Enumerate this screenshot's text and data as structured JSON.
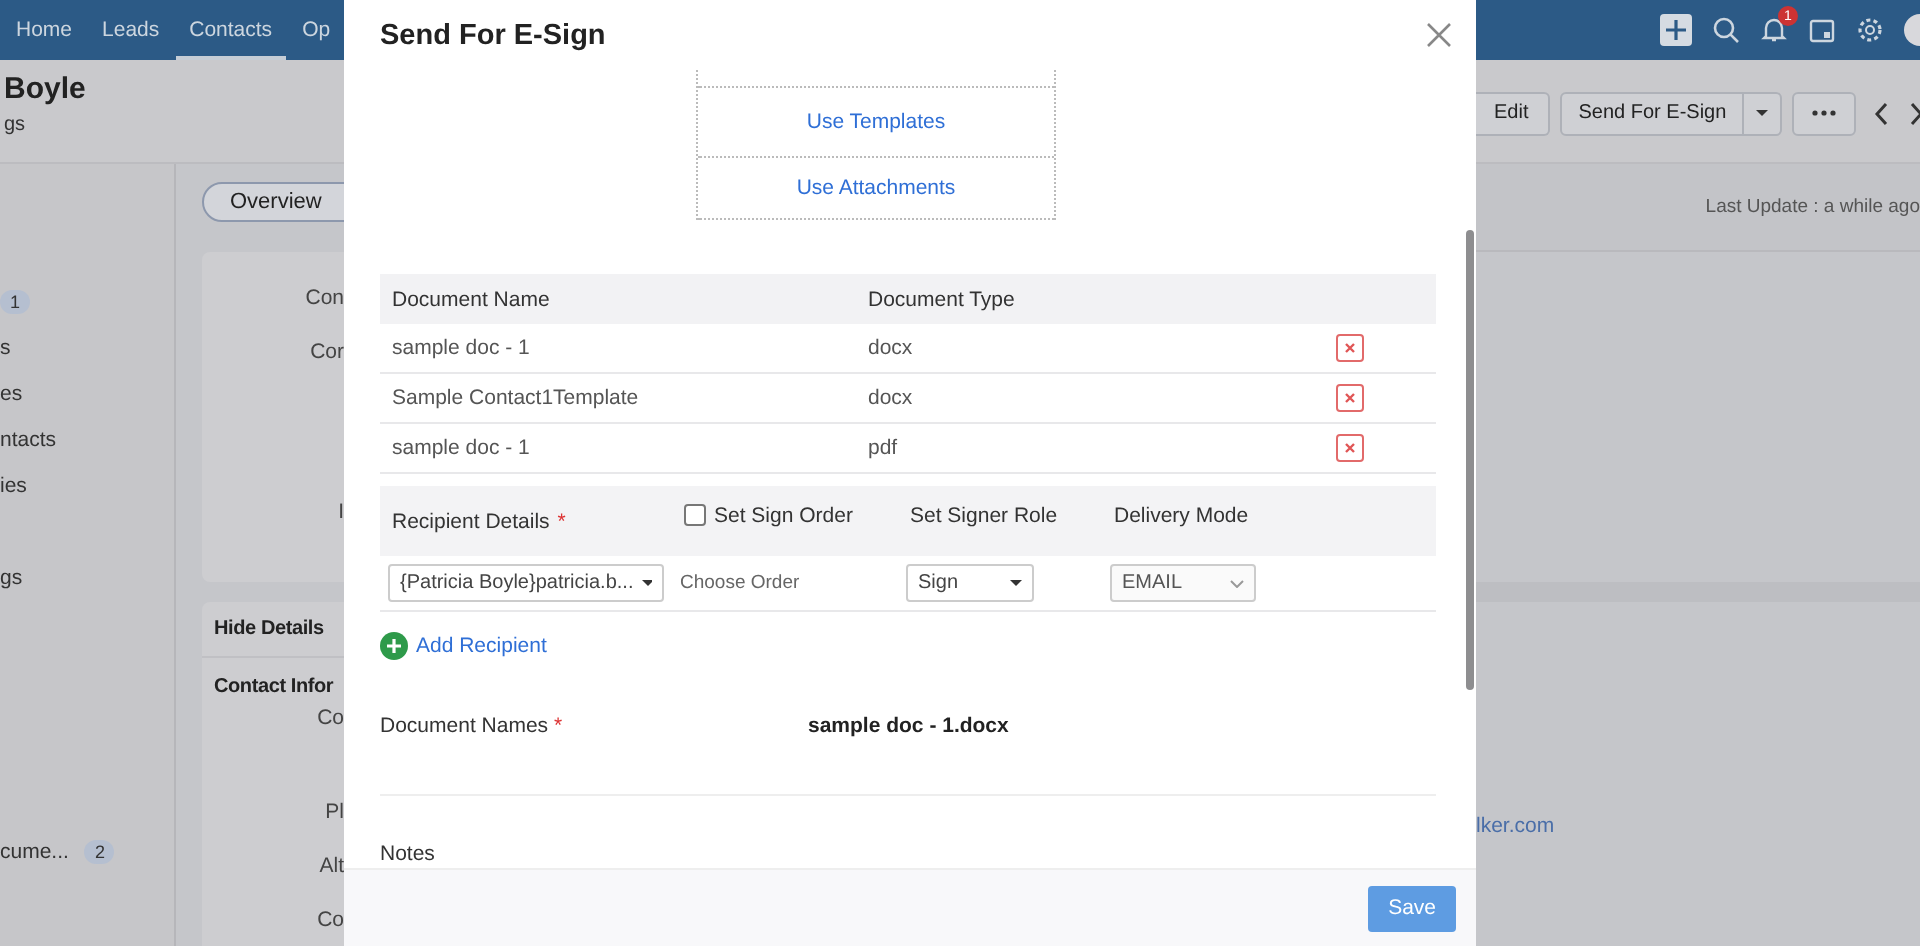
{
  "background_page": {
    "nav_tabs": [
      {
        "label": "Home",
        "selected": false
      },
      {
        "label": "Leads",
        "selected": false
      },
      {
        "label": "Contacts",
        "selected": true
      },
      {
        "label": "Op",
        "selected": false
      }
    ],
    "notification_count": "1",
    "record_title": "Boyle",
    "record_subtitle": "gs",
    "sidebar_items": [
      {
        "badge": "1"
      },
      {
        "label": "s"
      },
      {
        "label": "es"
      },
      {
        "label": "ntacts"
      },
      {
        "label": "ies"
      },
      {
        "label": "gs"
      },
      {
        "label": "cume...",
        "badge": "2"
      }
    ],
    "overview_tab": {
      "label": "Overview",
      "selected": true
    },
    "summary_labels": [
      "Con",
      "Cor",
      "I"
    ],
    "details_heading": "Hide Details",
    "details_section": "Contact Infor",
    "detail_labels": [
      "Co",
      "Pl",
      "Alt",
      "Co"
    ],
    "header_buttons": {
      "edit": "Edit",
      "esign": "Send For E-Sign"
    },
    "last_update": "Last Update : a while ago",
    "email_link": "lker.com"
  },
  "dialog": {
    "title": "Send For E-Sign",
    "source_options": [
      "Use Templates",
      "Use Attachments"
    ],
    "documents": {
      "columns": [
        "Document Name",
        "Document Type"
      ],
      "rows": [
        {
          "name": "sample doc - 1",
          "type": "docx"
        },
        {
          "name": "Sample Contact1Template",
          "type": "docx"
        },
        {
          "name": "sample doc - 1",
          "type": "pdf"
        }
      ]
    },
    "recipient_header": {
      "details_label": "Recipient Details",
      "required_mark": "*",
      "sign_order": {
        "label": "Set Sign Order",
        "checked": false
      },
      "role_label": "Set Signer Role",
      "delivery_label": "Delivery Mode"
    },
    "recipient_rows": [
      {
        "recipient": "{Patricia Boyle}patricia.b...",
        "order_placeholder": "Choose Order",
        "role": "Sign",
        "delivery": "EMAIL"
      }
    ],
    "add_recipient": "Add Recipient",
    "document_names": {
      "label": "Document Names",
      "required_mark": "*",
      "value": "sample doc - 1.docx"
    },
    "notes_label": "Notes",
    "save": "Save"
  }
}
